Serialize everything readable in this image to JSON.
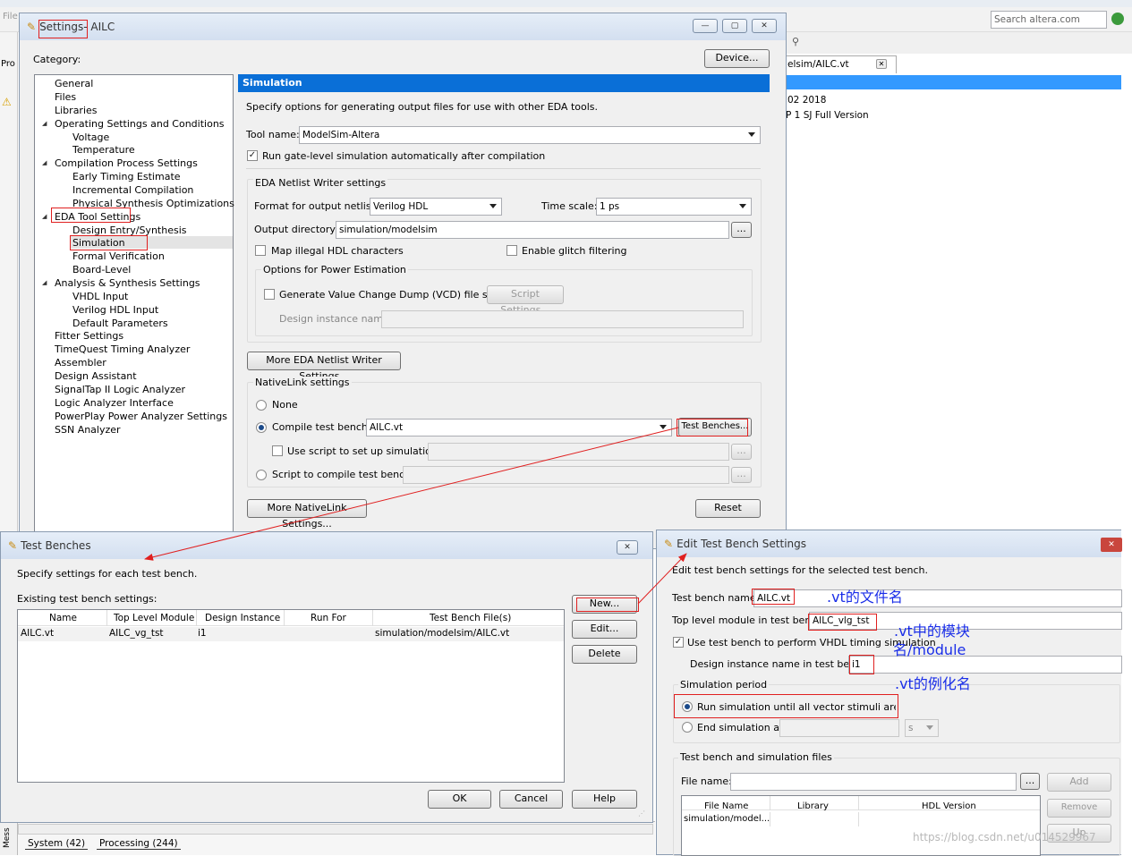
{
  "background": {
    "menu_file": "File",
    "panel_label": "Pro",
    "search_placeholder": "Search altera.com",
    "tab_vt": "elsim/AILC.vt",
    "info_line1": "02 2018",
    "info_line2": "P 1 SJ Full Version",
    "bottom_tabs": [
      "System (42)",
      "Processing (244)"
    ],
    "messages_label": "Mess"
  },
  "settings": {
    "title_settings": "Settings",
    "title_rest": " - AILC",
    "category_label": "Category:",
    "device_button": "Device...",
    "tree": [
      "General",
      "Files",
      "Libraries",
      "Operating Settings and Conditions",
      "Voltage",
      "Temperature",
      "Compilation Process Settings",
      "Early Timing Estimate",
      "Incremental Compilation",
      "Physical Synthesis Optimizations",
      "EDA Tool Settings",
      "Design Entry/Synthesis",
      "Simulation",
      "Formal Verification",
      "Board-Level",
      "Analysis & Synthesis Settings",
      "VHDL Input",
      "Verilog HDL Input",
      "Default Parameters",
      "Fitter Settings",
      "TimeQuest Timing Analyzer",
      "Assembler",
      "Design Assistant",
      "SignalTap II Logic Analyzer",
      "Logic Analyzer Interface",
      "PowerPlay Power Analyzer Settings",
      "SSN Analyzer"
    ],
    "panel_title": "Simulation",
    "panel_desc": "Specify options for generating output files for use with other EDA tools.",
    "tool_name_label": "Tool name:",
    "tool_name_value": "ModelSim-Altera",
    "run_gate_label": "Run gate-level simulation automatically after compilation",
    "eda_group_title": "EDA Netlist Writer settings",
    "format_label": "Format for output netlist:",
    "format_value": "Verilog HDL",
    "timescale_label": "Time scale:",
    "timescale_value": "1 ps",
    "outdir_label": "Output directory:",
    "outdir_value": "simulation/modelsim",
    "browse": "...",
    "map_illegal_label": "Map illegal HDL characters",
    "glitch_label": "Enable glitch filtering",
    "power_group_title": "Options for Power Estimation",
    "vcd_label": "Generate Value Change Dump (VCD) file script",
    "script_settings_button": "Script Settings...",
    "design_instance_label": "Design instance name:",
    "more_eda_button": "More EDA Netlist Writer Settings...",
    "nativelink_title": "NativeLink settings",
    "none_label": "None",
    "compile_tb_label": "Compile test bench:",
    "compile_tb_value": "AILC.vt",
    "test_benches_button": "Test Benches...",
    "use_script_label": "Use script to set up simulation:",
    "script_compile_label": "Script to compile test bench:",
    "more_nativelink_button": "More NativeLink Settings...",
    "reset_button": "Reset"
  },
  "test_benches": {
    "title": "Test Benches",
    "desc": "Specify settings for each test bench.",
    "existing_label": "Existing test bench settings:",
    "columns": [
      "Name",
      "Top Level Module",
      "Design Instance",
      "Run For",
      "Test Bench File(s)"
    ],
    "row": [
      "AILC.vt",
      "AILC_vg_tst",
      "i1",
      "",
      "simulation/modelsim/AILC.vt"
    ],
    "new_button": "New...",
    "edit_button": "Edit...",
    "delete_button": "Delete",
    "ok_button": "OK",
    "cancel_button": "Cancel",
    "help_button": "Help"
  },
  "edit_tb": {
    "title": "Edit Test Bench Settings",
    "desc": "Edit test bench settings for the selected test bench.",
    "tb_name_label": "Test bench name:",
    "tb_name_value": "AILC.vt",
    "top_module_label": "Top level module in test bench:",
    "top_module_value": "AILC_vlg_tst",
    "use_tb_label": "Use test bench to perform VHDL timing simulation",
    "design_inst_label": "Design instance name in test bench:",
    "design_inst_value": "i1",
    "sim_period_title": "Simulation period",
    "run_until_label": "Run simulation until all vector stimuli are used",
    "end_sim_label": "End simulation at:",
    "end_sim_unit": "s",
    "files_title": "Test bench and simulation files",
    "file_name_label": "File name:",
    "browse": "...",
    "add_button": "Add",
    "remove_button": "Remove",
    "up_button": "Up",
    "file_columns": [
      "File Name",
      "Library",
      "HDL Version"
    ],
    "file_row": "simulation/model..."
  },
  "annotations": {
    "vt_filename": ".vt的文件名",
    "vt_module_1": ".vt中的模块",
    "vt_module_2": "名/module",
    "vt_instance": ".vt的例化名"
  },
  "watermark": "https://blog.csdn.net/u014529967",
  "colors": {
    "selection_blue": "#0a6fd7",
    "annotation_red": "#e02020",
    "annotation_blue": "#1a2ee8"
  }
}
